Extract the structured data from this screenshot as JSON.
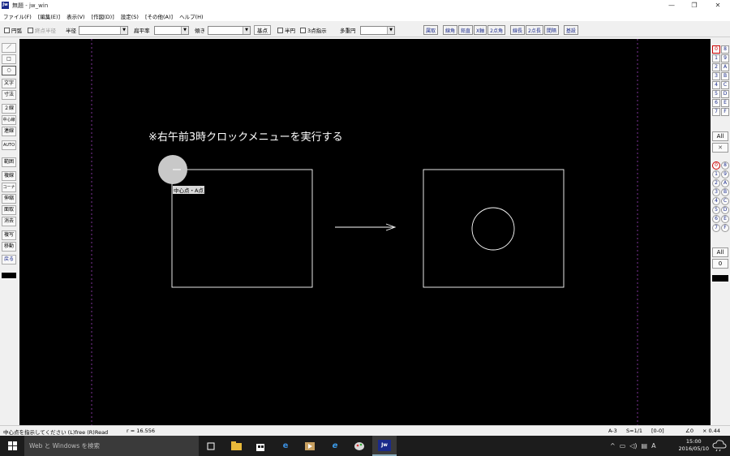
{
  "window": {
    "title": "無題 - jw_win",
    "app_icon": "Jw",
    "minimize": "—",
    "maximize": "❐",
    "close": "✕"
  },
  "menu": [
    "ファイル(F)",
    "[編集(E)]",
    "表示(V)",
    "[作図(D)]",
    "設定(S)",
    "[その他(A)]",
    "ヘルプ(H)"
  ],
  "toolbar": {
    "arc_label": "円弧",
    "arc_radius_label": "終点半径",
    "radius_label": "半径",
    "flatness_label": "扁平率",
    "tilt_label": "傾き",
    "base_point": "基点",
    "semicircle_label": "半円",
    "three_point_label": "3点指示",
    "multi_circle_label": "多重円",
    "right_buttons": [
      "属取",
      "線角",
      "鉛直",
      "X軸",
      "2点角",
      "線長",
      "2点長",
      "間隔",
      "基設"
    ]
  },
  "left_tools": [
    "／",
    "□",
    "○",
    "文字",
    "寸法",
    "２線",
    "中心線",
    "連線",
    "AUTO",
    "範囲",
    "複線",
    "コーナー",
    "伸縮",
    "面取",
    "消去",
    "複写",
    "移動",
    "戻る"
  ],
  "right_tools": {
    "group1": [
      "0",
      "8",
      "1",
      "9",
      "2",
      "A",
      "3",
      "B",
      "4",
      "C",
      "5",
      "D",
      "6",
      "E",
      "7",
      "F"
    ],
    "all1": "All",
    "x1": "✕",
    "group2": [
      "0",
      "8",
      "1",
      "9",
      "2",
      "A",
      "3",
      "B",
      "4",
      "C",
      "5",
      "D",
      "6",
      "E",
      "7",
      "F"
    ],
    "all2": "All",
    "zero": "0"
  },
  "canvas": {
    "instruction": "※右午前3時クロックメニューを実行する",
    "tooltip": "中心点・A点"
  },
  "status": {
    "message": "中心点を指示してください (L)free (R)Read",
    "radius": "r = 16.556",
    "paper": "A-3",
    "scale": "S=1/1",
    "layer": "[0-0]",
    "angle": "∠0",
    "zoom": "× 0.44"
  },
  "taskbar": {
    "search_placeholder": "Web と Windows を検索",
    "ime": "A",
    "time": "15:00",
    "date": "2016/05/10"
  }
}
